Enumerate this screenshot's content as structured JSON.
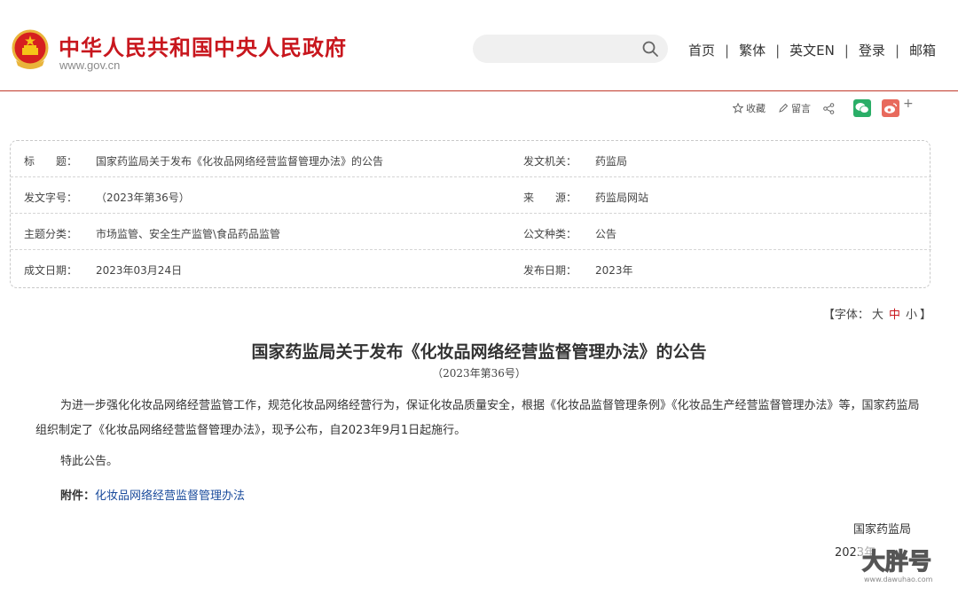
{
  "header": {
    "site_title": "中华人民共和国中央人民政府",
    "site_url": "www.gov.cn",
    "search_placeholder": "",
    "nav": [
      {
        "label": "首页"
      },
      {
        "label": "繁体"
      },
      {
        "label": "英文EN"
      },
      {
        "label": "登录"
      },
      {
        "label": "邮箱"
      }
    ]
  },
  "share": {
    "favorite_label": "收藏",
    "comment_label": "留言",
    "plus_label": "+"
  },
  "info": {
    "rows": [
      {
        "k1": "标　　题：",
        "v1": "国家药监局关于发布《化妆品网络经营监督管理办法》的公告",
        "k2": "发文机关：",
        "v2": "药监局"
      },
      {
        "k1": "发文字号：",
        "v1": "（2023年第36号）",
        "k2": "来　　源：",
        "v2": "药监局网站"
      },
      {
        "k1": "主题分类：",
        "v1": "市场监管、安全生产监管\\食品药品监管",
        "k2": "公文种类：",
        "v2": "公告"
      },
      {
        "k1": "成文日期：",
        "v1": "2023年03月24日",
        "k2": "发布日期：",
        "v2": "2023年"
      }
    ]
  },
  "font_size": {
    "prefix": "【字体：",
    "large": "大",
    "medium": "中",
    "small": "小",
    "suffix": "】"
  },
  "article": {
    "title": "国家药监局关于发布《化妆品网络经营监督管理办法》的公告",
    "doc_number": "（2023年第36号）",
    "paragraph1": "为进一步强化化妆品网络经营监管工作，规范化妆品网络经营行为，保证化妆品质量安全，根据《化妆品监督管理条例》《化妆品生产经营监督管理办法》等，国家药监局组织制定了《化妆品网络经营监督管理办法》，现予公布，自2023年9月1日起施行。",
    "paragraph2": "特此公告。",
    "attachment_label": "附件：",
    "attachment_link": "化妆品网络经营监督管理办法",
    "signature": "国家药监局",
    "signature_date": "2023年"
  },
  "colors": {
    "brand_red": "#c8161d",
    "link_blue": "#1a4b9c",
    "wechat_green": "#2aae67",
    "weibo_red": "#e86a5d"
  }
}
